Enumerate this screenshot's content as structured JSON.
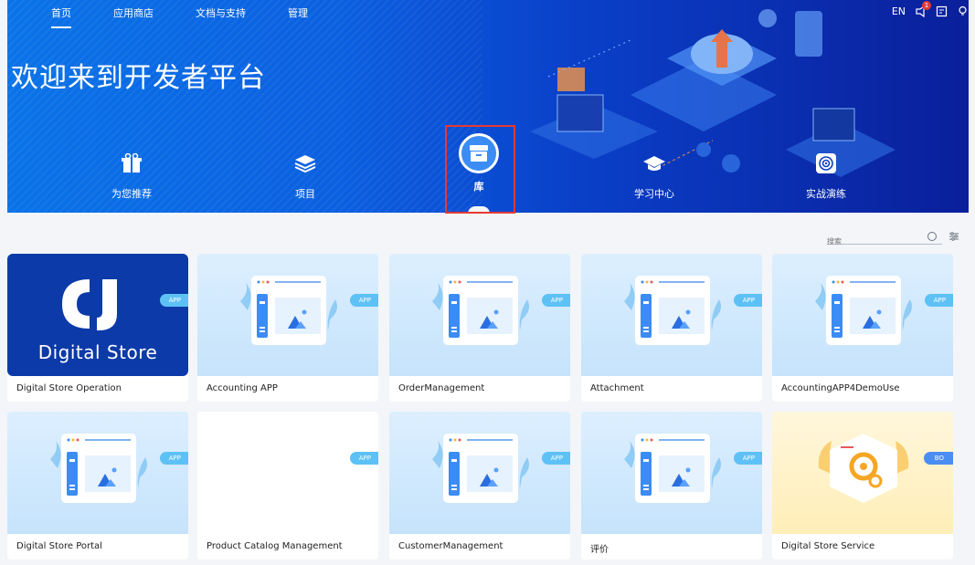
{
  "topnav": {
    "items": [
      {
        "label": "首页",
        "active": true
      },
      {
        "label": "应用商店",
        "active": false
      },
      {
        "label": "文档与支持",
        "active": false
      },
      {
        "label": "管理",
        "active": false
      }
    ],
    "lang": "EN",
    "notification_count": "1"
  },
  "banner": {
    "welcome": "欢迎来到开发者平台",
    "quick_links": [
      {
        "label": "为您推荐",
        "icon": "gift-icon"
      },
      {
        "label": "项目",
        "icon": "layers-icon"
      },
      {
        "label": "库",
        "icon": "archive-icon",
        "selected": true
      },
      {
        "label": "学习中心",
        "icon": "graduation-cap-icon"
      },
      {
        "label": "实战演练",
        "icon": "target-icon"
      }
    ]
  },
  "search": {
    "placeholder": "搜索"
  },
  "cards": [
    {
      "title": "Digital Store Operation",
      "tag": "APP",
      "style": "ds",
      "logo_text": "Digital Store"
    },
    {
      "title": "Accounting APP",
      "tag": "APP",
      "style": "mock"
    },
    {
      "title": "OrderManagement",
      "tag": "APP",
      "style": "mock"
    },
    {
      "title": "Attachment",
      "tag": "APP",
      "style": "mock"
    },
    {
      "title": "AccountingAPP4DemoUse",
      "tag": "APP",
      "style": "mock"
    },
    {
      "title": "Digital Store Portal",
      "tag": "APP",
      "style": "mock"
    },
    {
      "title": "Product Catalog Management",
      "tag": "APP",
      "style": "white"
    },
    {
      "title": "CustomerManagement",
      "tag": "APP",
      "style": "mock"
    },
    {
      "title": "评价",
      "tag": "APP",
      "style": "mock"
    },
    {
      "title": "Digital Store Service",
      "tag": "BO",
      "style": "bo"
    }
  ],
  "colors": {
    "banner": "#0a5fe0",
    "tag": "#5ec1f5",
    "selected_border": "#e53935"
  }
}
